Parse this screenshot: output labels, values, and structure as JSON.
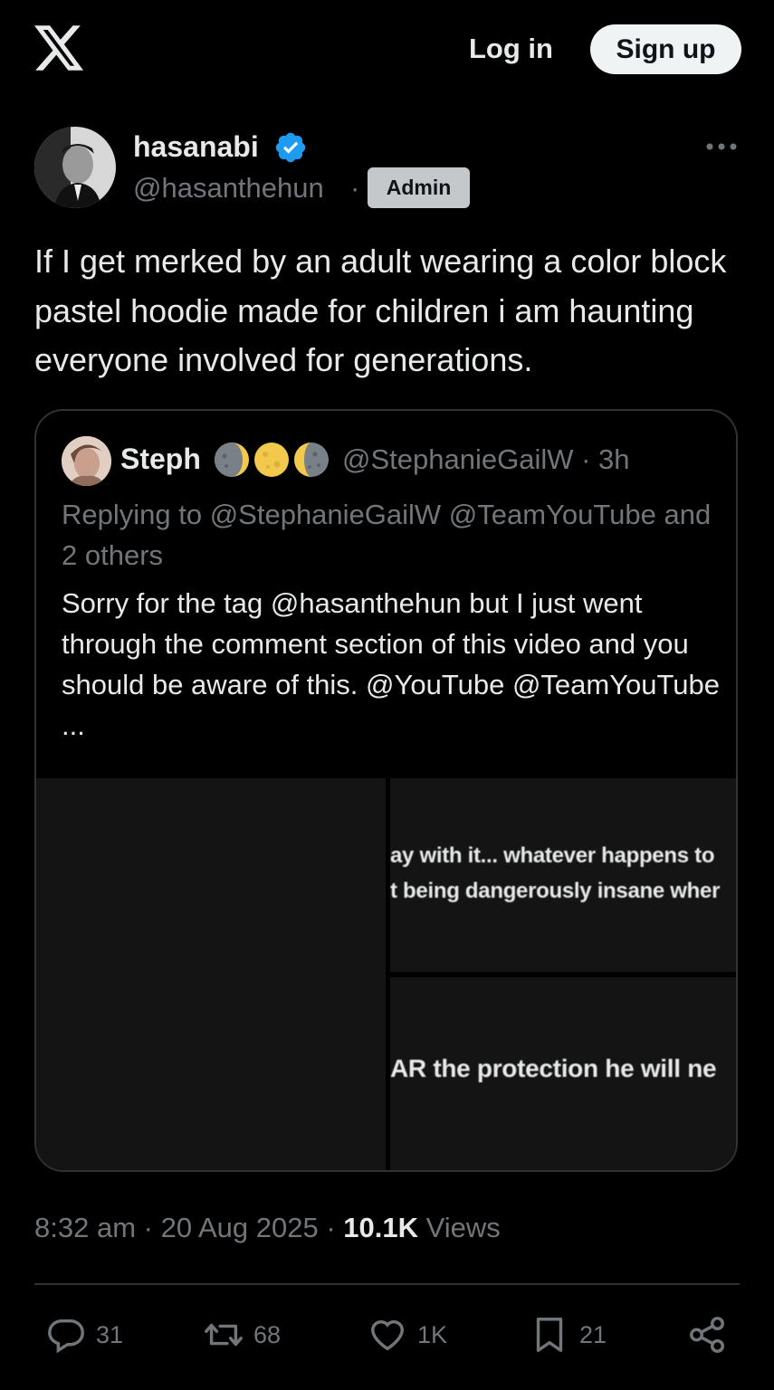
{
  "header": {
    "logo": "x-logo-icon",
    "login_label": "Log in",
    "signup_label": "Sign up"
  },
  "author": {
    "name": "hasanabi",
    "handle": "@hasanthehun",
    "separator": "·",
    "badge": "Admin",
    "verified": true,
    "verified_color": "#1d9bf0"
  },
  "tweet": {
    "text": "If I get merked by an adult wearing a color block pastel hoodie made for children i am haunting everyone involved for generations."
  },
  "quoted": {
    "name": "Steph",
    "emoji": [
      "moon-phase-icon",
      "full-moon-icon",
      "moon-phase-icon"
    ],
    "handle_time": "@StephanieGailW · 3h",
    "reply_to": "Replying to @StephanieGailW @TeamYouTube and 2 others",
    "text": "Sorry for the tag @hasanthehun but I just went through the comment section of this video and you should be aware of this. @YouTube @TeamYouTube ...",
    "media": {
      "top_caption_1": "ay with it... whatever happens to",
      "top_caption_2": "t being dangerously insane wher",
      "bottom_caption": "AR the protection he will ne"
    }
  },
  "meta": {
    "time": "8:32 am",
    "date": "20 Aug 2025",
    "sep": "·",
    "views_count": "10.1K",
    "views_label": "Views"
  },
  "actions": {
    "replies": "31",
    "reposts": "68",
    "likes": "1K",
    "bookmarks": "21"
  }
}
